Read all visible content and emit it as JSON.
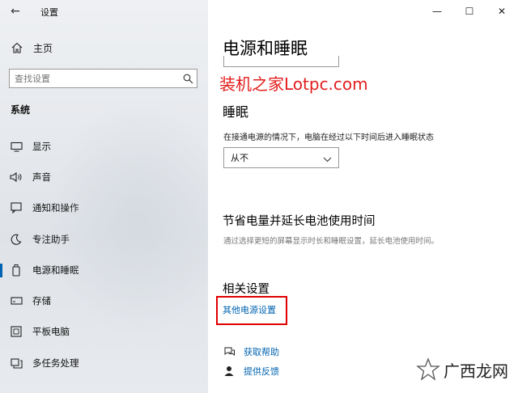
{
  "window": {
    "title": "设置",
    "back_glyph": "←",
    "controls": {
      "minimize": "—",
      "maximize": "☐",
      "close": "✕"
    }
  },
  "sidebar": {
    "home": "主页",
    "search_placeholder": "查找设置",
    "section": "系统",
    "items": [
      {
        "label": "显示",
        "icon": "display-icon"
      },
      {
        "label": "声音",
        "icon": "speaker-icon"
      },
      {
        "label": "通知和操作",
        "icon": "notification-icon"
      },
      {
        "label": "专注助手",
        "icon": "moon-icon"
      },
      {
        "label": "电源和睡眠",
        "icon": "power-icon",
        "active": true
      },
      {
        "label": "存储",
        "icon": "storage-icon"
      },
      {
        "label": "平板电脑",
        "icon": "tablet-icon"
      },
      {
        "label": "多任务处理",
        "icon": "multitask-icon"
      }
    ]
  },
  "main": {
    "page_title": "电源和睡眠",
    "watermark": "装机之家Lotpc.com",
    "sleep": {
      "title": "睡眠",
      "description": "在接通电源的情况下，电脑在经过以下时间后进入睡眠状态",
      "selected_value": "从不"
    },
    "battery": {
      "title": "节省电量并延长电池使用时间",
      "description": "通过选择更短的屏幕显示时长和睡眠设置，延长电池使用时间。"
    },
    "related": {
      "title": "相关设置",
      "link": "其他电源设置"
    },
    "help": {
      "get_help": "获取帮助",
      "feedback": "提供反馈"
    },
    "brand": "广西龙网"
  },
  "colors": {
    "accent": "#0063b1",
    "highlight_red": "#e10000"
  }
}
